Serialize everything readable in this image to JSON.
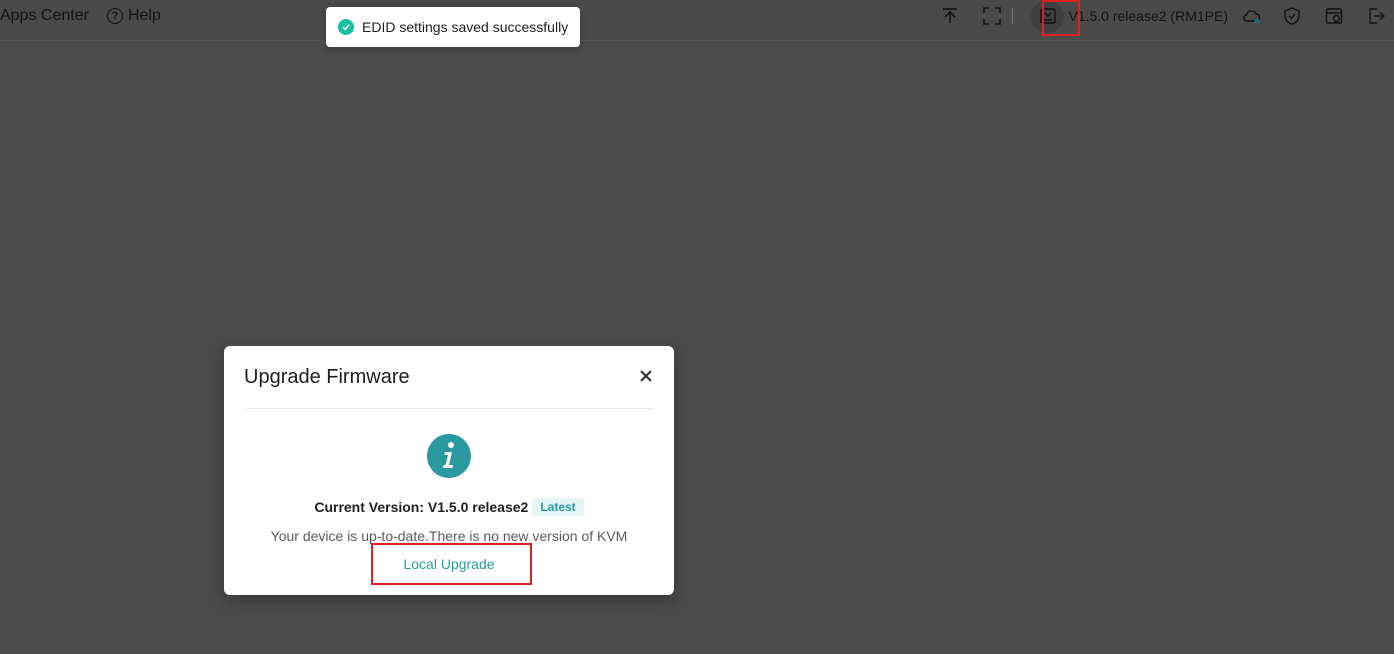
{
  "topbar": {
    "apps_center": "Apps Center",
    "help": "Help",
    "version": "V1.5.0 release2 (RM1PE)",
    "icons": [
      "upload-icon",
      "fullscreen-icon",
      "firmware-icon",
      "cloud-icon",
      "shield-icon",
      "calendar-sync-icon",
      "logout-icon"
    ]
  },
  "toast": {
    "message": "EDID settings saved successfully",
    "color": "#14c2a3"
  },
  "modal": {
    "title": "Upgrade Firmware",
    "current_version": "Current Version: V1.5.0 release2",
    "badge": "Latest",
    "message": "Your device is up-to-date.There is no new version of KVM",
    "local_upgrade": "Local Upgrade",
    "accent": "#2b9aa0"
  }
}
